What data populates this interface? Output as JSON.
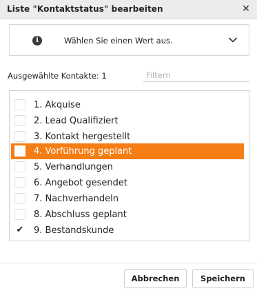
{
  "dialog": {
    "title": "Liste \"Kontaktstatus\" bearbeiten",
    "close_icon": "close-icon"
  },
  "info": {
    "icon": "info-icon",
    "text": "Wählen Sie einen Wert aus.",
    "toggle_icon": "chevron-down-icon"
  },
  "selection": {
    "label": "Ausgewählte Kontakte: 1"
  },
  "filter": {
    "placeholder": "Filtern",
    "value": ""
  },
  "items": [
    {
      "label": "1. Akquise",
      "checked": false,
      "highlighted": false
    },
    {
      "label": "2. Lead Qualifiziert",
      "checked": false,
      "highlighted": false
    },
    {
      "label": "3. Kontakt hergestellt",
      "checked": false,
      "highlighted": false
    },
    {
      "label": "4. Vorführung geplant",
      "checked": false,
      "highlighted": true
    },
    {
      "label": "5. Verhandlungen",
      "checked": false,
      "highlighted": false
    },
    {
      "label": "6. Angebot gesendet",
      "checked": false,
      "highlighted": false
    },
    {
      "label": "7. Nachverhandeln",
      "checked": false,
      "highlighted": false
    },
    {
      "label": "8. Abschluss geplant",
      "checked": false,
      "highlighted": false
    },
    {
      "label": "9. Bestandskunde",
      "checked": true,
      "highlighted": false
    }
  ],
  "buttons": {
    "cancel": "Abbrechen",
    "save": "Speichern"
  },
  "colors": {
    "highlight": "#f47d14",
    "titlebar": "#ececec"
  }
}
